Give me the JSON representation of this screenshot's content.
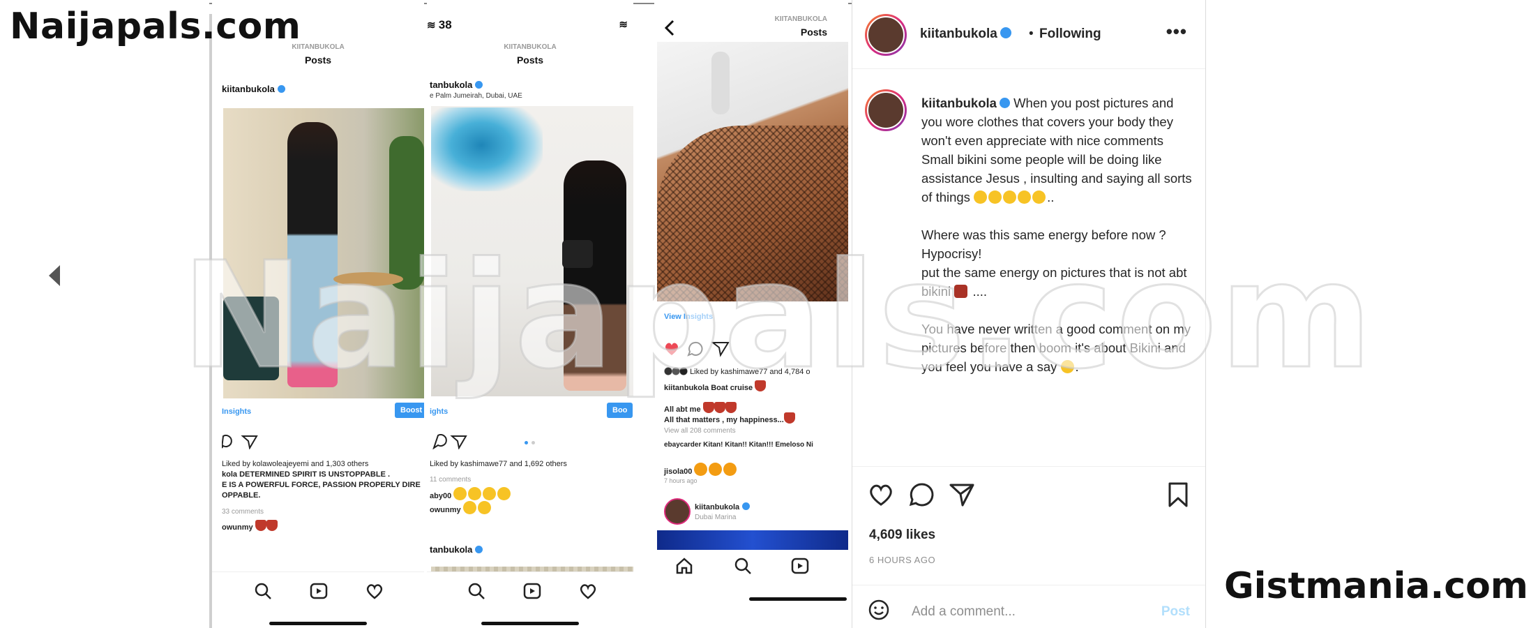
{
  "watermarks": {
    "top_left": "Naijapals.com",
    "bottom_right": "Gistmania.com",
    "center": "Naijapals.com"
  },
  "phone1": {
    "username": "kiitanbukola",
    "header_small": "KIITANBUKOLA",
    "header": "Posts",
    "insights": "Insights",
    "boost": "Boost",
    "liked_by": "Liked by kolawoleajeyemi and 1,303 others",
    "caption_lines": [
      "kola DETERMINED SPIRIT IS UNSTOPPABLE .",
      "E IS A POWERFUL FORCE, PASSION PROPERLY DIRE",
      "OPPABLE."
    ],
    "comments_count": "33 comments",
    "comment1": "owunmy",
    "comment2": ""
  },
  "phone2": {
    "status_time": "38",
    "header_small": "KIITANBUKOLA",
    "header": "Posts",
    "username": "tanbukola",
    "location": "e Palm Jumeirah, Dubai, UAE",
    "insights": "ights",
    "boost": "Boo",
    "liked_by": "Liked by kashimawe77 and 1,692 others",
    "comments_count": "11 comments",
    "comment1": "aby00",
    "comment2": "owunmy",
    "next_user": "tanbukola"
  },
  "phone3": {
    "header_small": "KIITANBUKOLA",
    "header": "Posts",
    "view_insights": "View Insights",
    "liked_by": "Liked by kashimawe77 and 4,784 o",
    "caption": "kiitanbukola Boat cruise",
    "comment_a": "All abt me",
    "comment_b": "All that matters , my happiness...",
    "view_all": "View all 208 comments",
    "comment_c": "ebaycarder Kitan! Kitan!! Kitan!!! Emeloso Ni",
    "comment_d": "jisola00",
    "time": "7 hours ago",
    "next_user": "kiitanbukola",
    "next_loc": "Dubai Marina"
  },
  "post": {
    "username": "kiitanbukola",
    "separator": "•",
    "follow_state": "Following",
    "more": "•••",
    "caption_user": "kiitanbukola",
    "caption_p1": " When you post pictures and you wore clothes that covers your body they won't even appreciate with nice comments",
    "caption_p2": "Small bikini some people will be doing like assistance Jesus , insulting and saying all sorts of things ",
    "caption_p2_end": "..",
    "caption_p3": "Where was this same energy before now ?",
    "caption_p4": "Hypocrisy!",
    "caption_p5": "put the same energy on pictures that is not abt bikini ",
    "caption_p5_end": " ....",
    "caption_p6": "You have never written a good comment on my pictures before then boom it's about Bikini and you feel you have a say ",
    "caption_p6_end": ".",
    "likes": "4,609 likes",
    "time_ago": "6 HOURS AGO",
    "add_comment": "Add a comment...",
    "post_button": "Post"
  }
}
